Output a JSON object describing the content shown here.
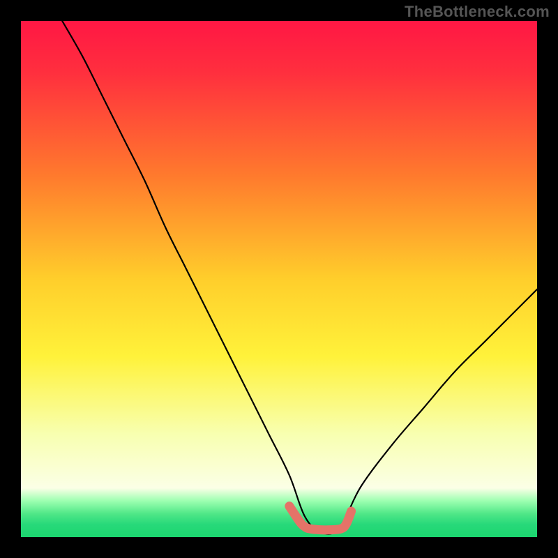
{
  "watermark": "TheBottleneck.com",
  "chart_data": {
    "type": "line",
    "title": "",
    "xlabel": "",
    "ylabel": "",
    "xlim": [
      0,
      100
    ],
    "ylim": [
      0,
      100
    ],
    "gradient_stops": [
      {
        "offset": 0.0,
        "color": "#ff1744"
      },
      {
        "offset": 0.1,
        "color": "#ff2f3e"
      },
      {
        "offset": 0.3,
        "color": "#ff7a2d"
      },
      {
        "offset": 0.5,
        "color": "#ffce2b"
      },
      {
        "offset": 0.65,
        "color": "#fff23a"
      },
      {
        "offset": 0.8,
        "color": "#f8ffb0"
      },
      {
        "offset": 0.905,
        "color": "#fbffe6"
      },
      {
        "offset": 0.93,
        "color": "#9cffb0"
      },
      {
        "offset": 0.955,
        "color": "#4fe787"
      },
      {
        "offset": 0.975,
        "color": "#28d97a"
      },
      {
        "offset": 1.0,
        "color": "#1bd66f"
      }
    ],
    "series": [
      {
        "name": "bottleneck-curve",
        "note": "V-shaped curve: y ≈ 100 at x≈8, falls to ~0 near x≈55–63 (flat bottom), rises to ~48 at x=100",
        "x": [
          8,
          12,
          16,
          20,
          24,
          28,
          32,
          36,
          40,
          44,
          48,
          52,
          55,
          58,
          61,
          63,
          66,
          72,
          78,
          84,
          90,
          96,
          100
        ],
        "y": [
          100,
          93,
          85,
          77,
          69,
          60,
          52,
          44,
          36,
          28,
          20,
          12,
          4,
          1,
          1,
          4,
          10,
          18,
          25,
          32,
          38,
          44,
          48
        ]
      },
      {
        "name": "bottom-highlight",
        "note": "thick salmon segment marking the flat minimum region",
        "x": [
          52,
          54,
          55,
          56,
          58,
          60,
          62,
          63,
          64
        ],
        "y": [
          6,
          3,
          2,
          1.6,
          1.4,
          1.4,
          1.6,
          2.5,
          5
        ]
      }
    ]
  }
}
